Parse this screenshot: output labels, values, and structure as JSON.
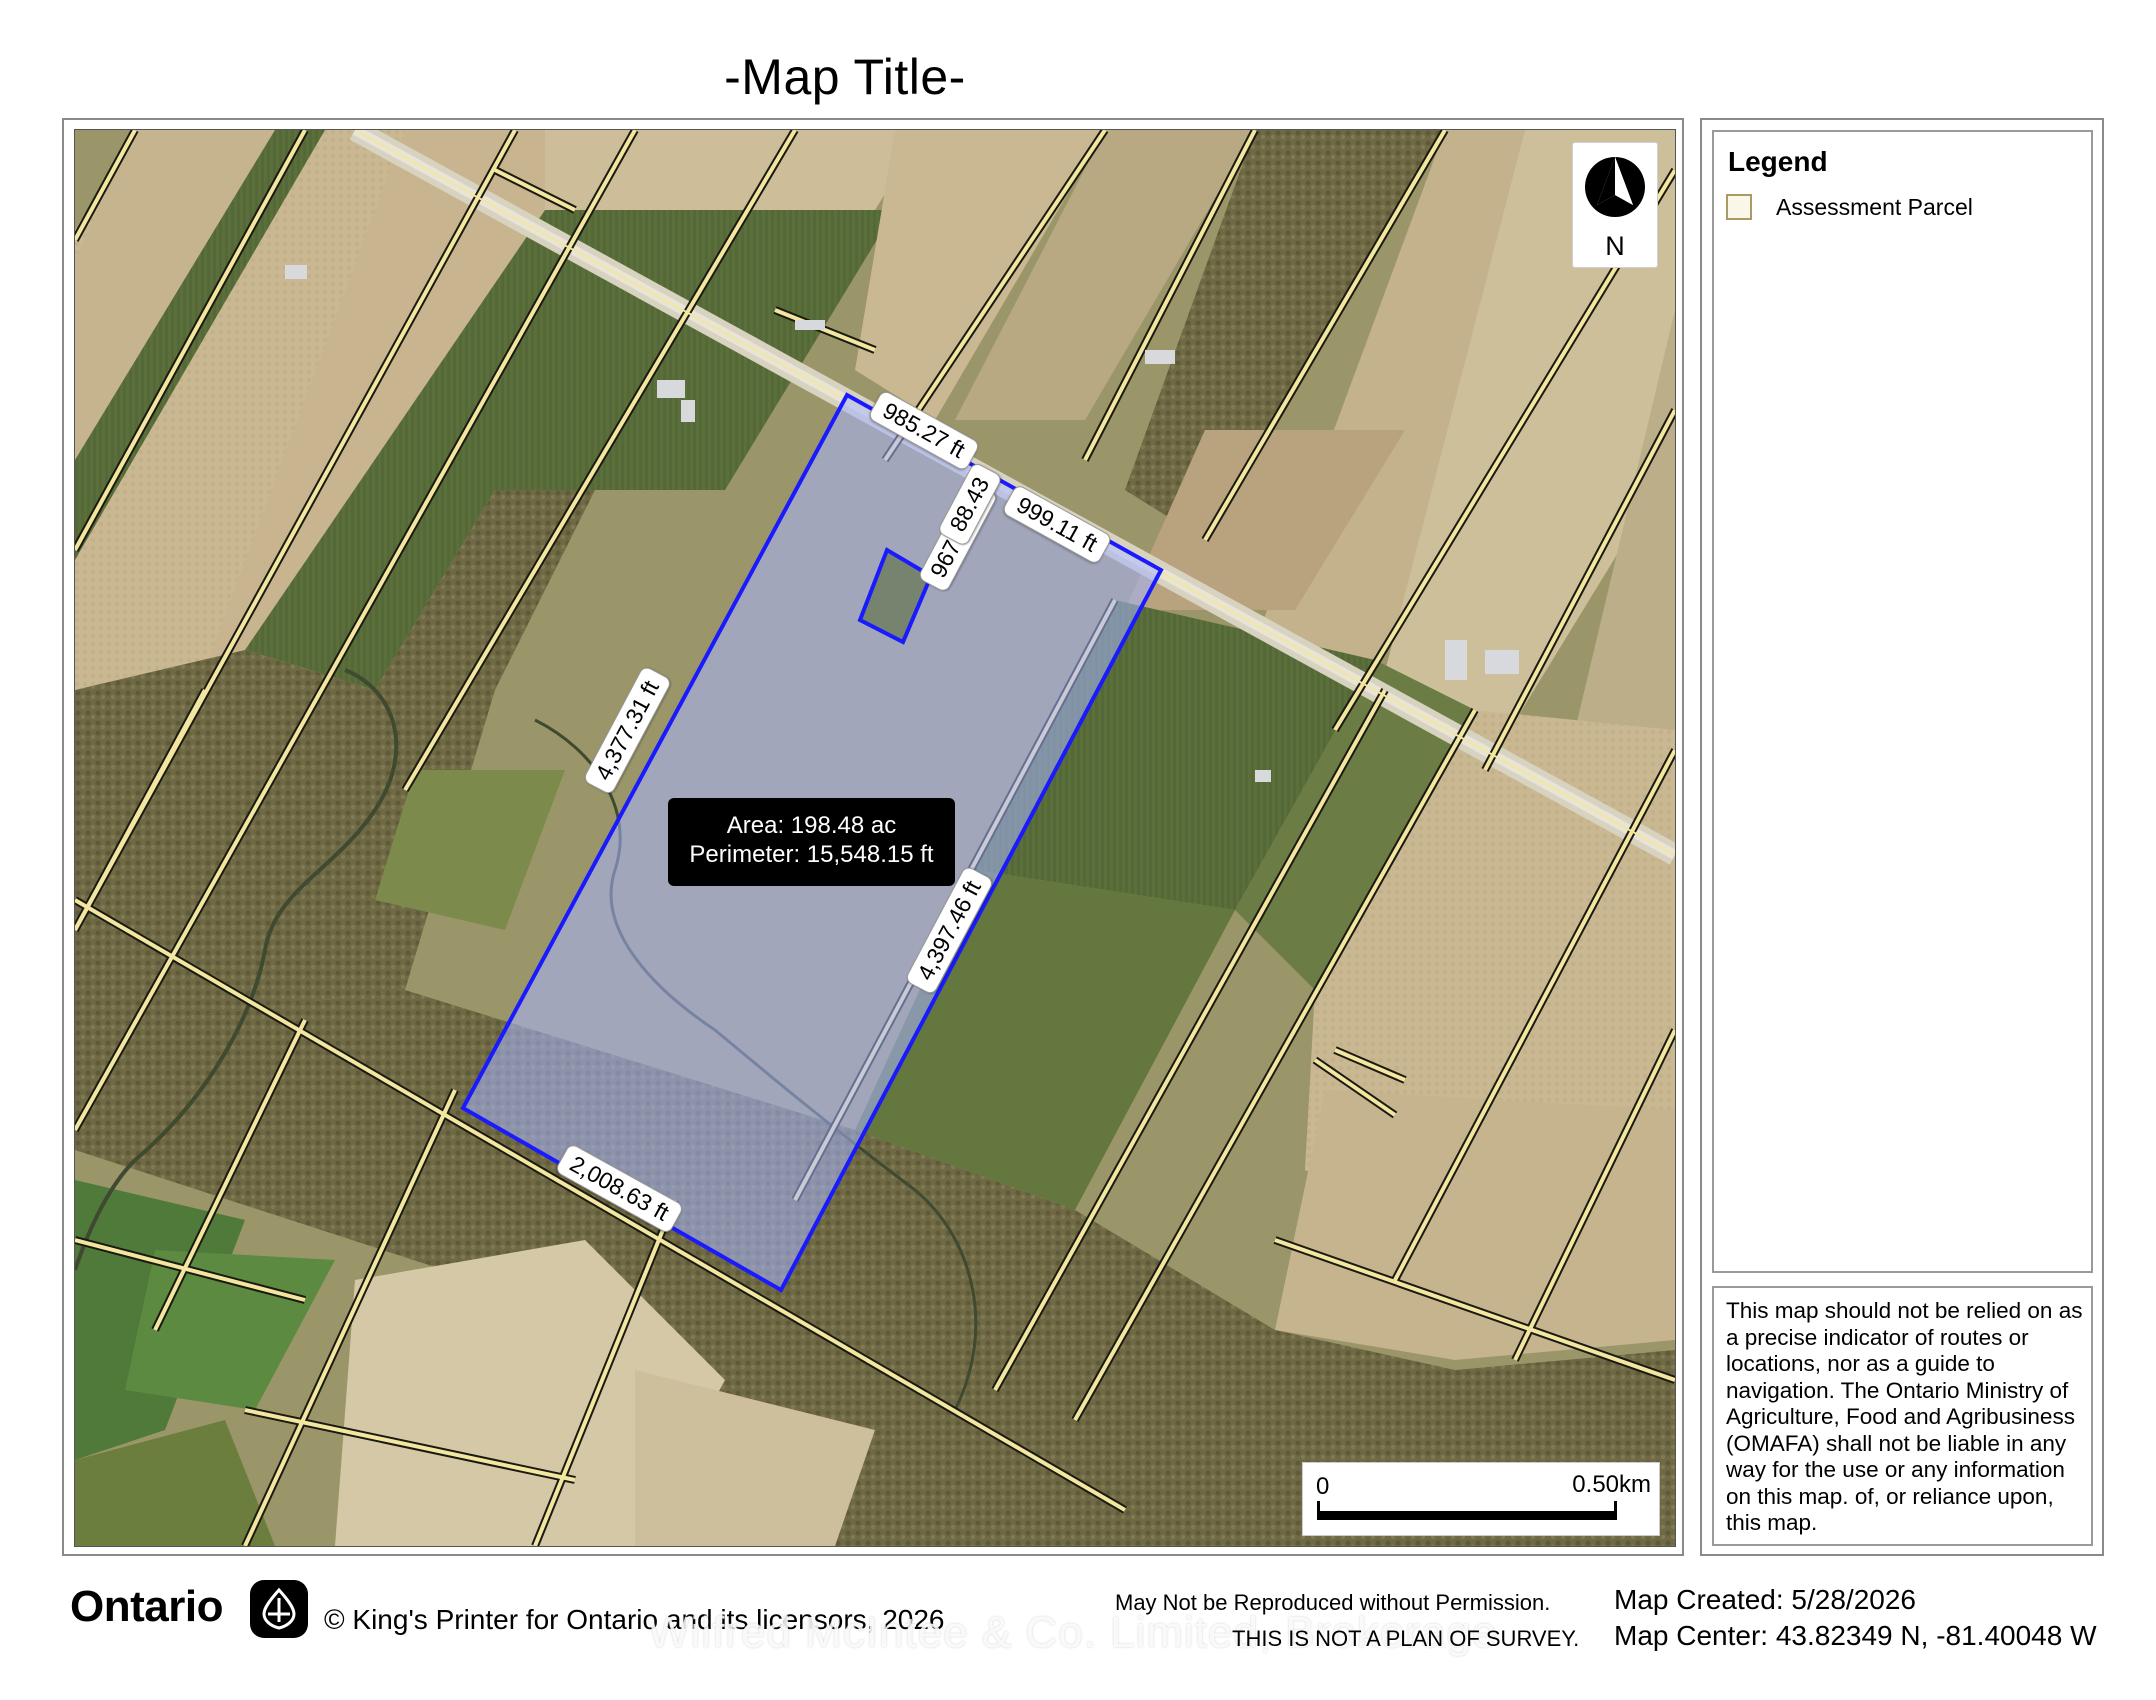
{
  "map_title": "-Map Title-",
  "north_arrow": {
    "label": "N",
    "icon": "north-arrow-icon"
  },
  "scale_bar": {
    "start": "0",
    "end": "0.50km"
  },
  "legend": {
    "title": "Legend",
    "items": [
      {
        "label": "Assessment Parcel",
        "fill": "#fbf7e8",
        "stroke": "#a99a66"
      }
    ]
  },
  "disclaimer": "This map should not be relied on as a precise indicator of routes or locations, nor as a guide to navigation. The Ontario Ministry of Agriculture, Food and Agribusiness (OMAFA) shall not be liable in any way for the use or any information on this map. of, or reliance upon, this map.",
  "measurement": {
    "area": "Area: 198.48 ac",
    "perimeter": "Perimeter: 15,548.15 ft",
    "edges": [
      "985.27 ft",
      "999.11 ft",
      "967.72 ft",
      "4,377.31 ft",
      "4,397.46 ft",
      "2,008.63 ft"
    ],
    "overlap_text": "88.43"
  },
  "footer": {
    "ontario_logo": "Ontario",
    "copyright": "© King's Printer for Ontario and its licensors, 2026",
    "watermark": "Wilfred McIntee & Co. Limited, Brokerage",
    "notice1": "May Not be Reproduced without Permission.",
    "notice2": "THIS IS NOT A PLAN OF SURVEY.",
    "created": "Map Created: 5/28/2026",
    "center": "Map Center:  43.82349 N, -81.40048 W"
  },
  "colors": {
    "parcel_line": "#f3e6a0",
    "selection_stroke": "#1a1aff",
    "selection_fill": "rgba(160,175,255,0.55)"
  }
}
